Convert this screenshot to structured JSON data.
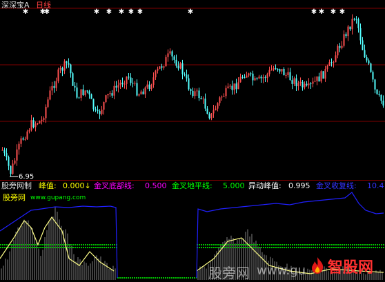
{
  "header": {
    "stock_name": "深深宝A",
    "period": "日线"
  },
  "price_panel": {
    "low_label": "6.95"
  },
  "indicator_bar": {
    "name": "股旁网制",
    "items": [
      {
        "label": "峰值:",
        "value": "0.000↓",
        "color": "#ffff00"
      },
      {
        "label": "金叉底部线:",
        "value": "0.500",
        "color": "#ff00ff"
      },
      {
        "label": "金叉地平线:",
        "value": "5.000",
        "color": "#00ff00"
      },
      {
        "label": "异动峰值:",
        "value": "0.995",
        "color": "#ffffff"
      },
      {
        "label": "金叉收复线:",
        "value": "10.4",
        "color": "#3333ff"
      }
    ]
  },
  "sub_panel": {
    "site_name": "股旁网",
    "site_url": "www.gupang.com"
  },
  "watermark": {
    "left_text": "股旁网",
    "mid_text": "www.gu",
    "right_text": "智股网"
  },
  "colors": {
    "up": "#ff5050",
    "down": "#54ffff",
    "grid": "#800000",
    "indicator_blue": "#2020ff",
    "indicator_green": "#00c000"
  }
}
